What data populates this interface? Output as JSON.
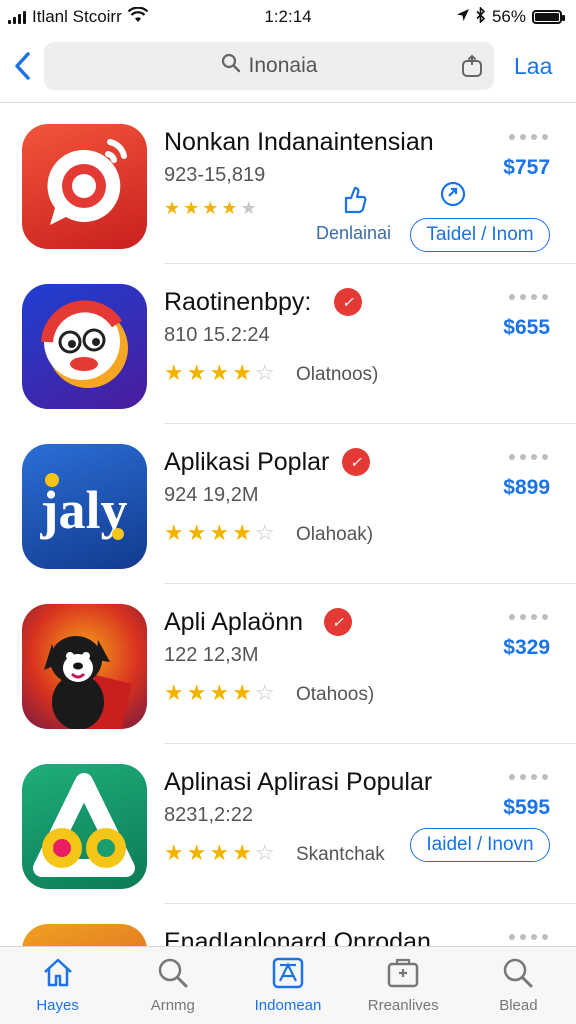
{
  "status": {
    "carrier": "Itlanl Stcoirr",
    "time": "1:2:14",
    "battery": "56%"
  },
  "search": {
    "query": "Inonaia",
    "cancel": "Laa"
  },
  "apps": [
    {
      "name": "Nonkan Indanaintensian",
      "sub": "923-15,819",
      "rating": 4,
      "price": "$757",
      "action_left": "Denlainai",
      "pill_left": "Taidel",
      "pill_right": "Inom",
      "accent": "#e53935"
    },
    {
      "name": "Raotinenbpy:",
      "sub": "810 15.2:24",
      "rating": 4,
      "review": "Olatnoos)",
      "price": "$655",
      "accent": "#3b2bb5"
    },
    {
      "name": "Aplikasi Poplar",
      "sub": "924 19,2M",
      "rating": 4,
      "review": "Olahoak)",
      "price": "$899",
      "accent": "#1e5bb8"
    },
    {
      "name": "Apli Aplaönn",
      "sub": "122 12,3M",
      "rating": 3.5,
      "review": "Otahoos)",
      "price": "$329",
      "accent": "#c72e2e"
    },
    {
      "name": "Aplinasi Aplirasi Popular",
      "sub": "8231,2:22",
      "rating": 3.5,
      "review": "Skantchak",
      "price": "$595",
      "pill_left": "Iaidel",
      "pill_right": "Inovn",
      "accent": "#13996a"
    },
    {
      "name": "EnadIanlonard Onrodan",
      "accent": "#f0a020"
    }
  ],
  "tabs": [
    {
      "label": "Hayes",
      "icon": "home-icon",
      "active": true
    },
    {
      "label": "Arnmg",
      "icon": "search-icon",
      "active": false
    },
    {
      "label": "Indomean",
      "icon": "apps-icon",
      "active": false
    },
    {
      "label": "Rreanlives",
      "icon": "folder-icon",
      "active": false
    },
    {
      "label": "Blead",
      "icon": "search-icon",
      "active": false
    }
  ],
  "colors": {
    "accent": "#1a73e8",
    "star": "#f2b400",
    "badge": "#e53935"
  }
}
